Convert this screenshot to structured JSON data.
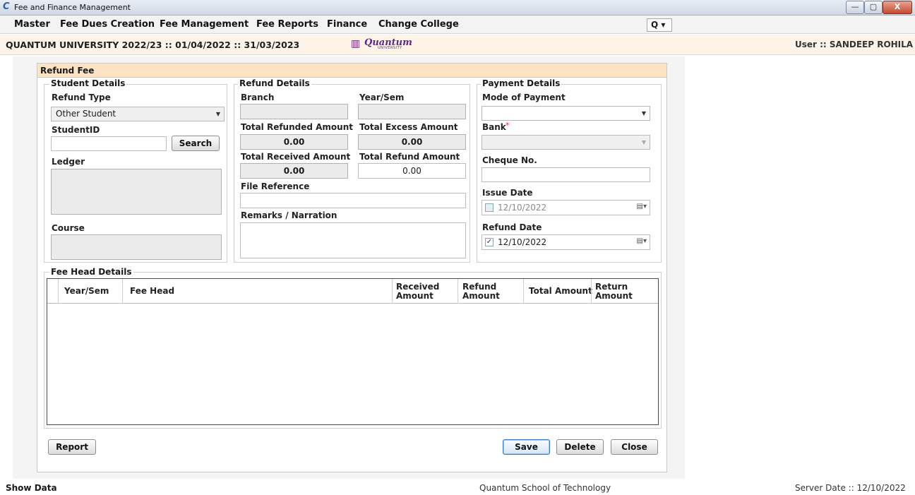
{
  "window": {
    "title": "Fee and Finance Management",
    "app_icon": "C",
    "controls": {
      "minimize": "—",
      "maximize": "▢",
      "close": "X"
    }
  },
  "menu": {
    "items": [
      "Master",
      "Fee Dues Creation",
      "Fee Management",
      "Fee Reports",
      "Finance",
      "Change College"
    ],
    "search_label": "Q ▾"
  },
  "info": {
    "session": "QUANTUM UNIVERSITY 2022/23 :: 01/04/2022 :: 31/03/2023",
    "logo_word": "Quantum",
    "logo_sub": "UNIVERSITY",
    "user": "User ::  SANDEEP ROHILA"
  },
  "panel": {
    "title": "Refund Fee",
    "student": {
      "legend": "Student Details",
      "refund_type_label": "Refund Type",
      "refund_type_value": "Other Student",
      "student_id_label": "StudentID",
      "student_id_value": "",
      "search_button": "Search",
      "ledger_label": "Ledger",
      "course_label": "Course"
    },
    "refund": {
      "legend": "Refund Details",
      "branch_label": "Branch",
      "year_sem_label": "Year/Sem",
      "total_refunded_label": "Total Refunded Amount",
      "total_refunded_value": "0.00",
      "total_excess_label": "Total Excess Amount",
      "total_excess_value": "0.00",
      "total_received_label": "Total Received Amount",
      "total_received_value": "0.00",
      "total_refund_label": "Total Refund Amount",
      "total_refund_value": "0.00",
      "file_reference_label": "File Reference",
      "remarks_label": "Remarks / Narration"
    },
    "payment": {
      "legend": "Payment Details",
      "mode_label": "Mode of Payment",
      "mode_value": "",
      "bank_label": "Bank",
      "required_mark": "*",
      "cheque_label": "Cheque No.",
      "issue_date_label": "Issue Date",
      "issue_date_value": "12/10/2022",
      "issue_date_checked": false,
      "refund_date_label": "Refund Date",
      "refund_date_value": "12/10/2022",
      "refund_date_checked": true,
      "checkmark": "✓",
      "calendar_glyph": "▤▾"
    },
    "fee_head": {
      "legend": "Fee Head Details",
      "columns": [
        "Year/Sem",
        "Fee Head",
        "Received Amount",
        "Refund Amount",
        "Total Amount",
        "Return Amount"
      ],
      "rows": []
    },
    "buttons": {
      "report": "Report",
      "save": "Save",
      "delete": "Delete",
      "close": "Close"
    }
  },
  "status": {
    "left": "Show Data",
    "center": "Quantum School of Technology",
    "right": "Server Date :: 12/10/2022"
  }
}
